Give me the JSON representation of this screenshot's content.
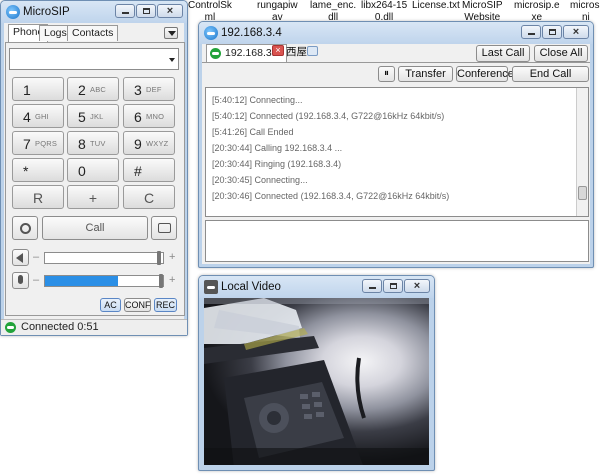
{
  "desktop_icons": [
    "ControlSk\nml",
    "rungapiw\nav",
    "lame_enc.\ndll",
    "libx264-15\n0.dll",
    "License.txt",
    "MicroSIP\nWebsite",
    "microsip.e\nxe",
    "microsi\nni"
  ],
  "microsip": {
    "title": "MicroSIP",
    "tabs": [
      "Phone",
      "Logs",
      "Contacts"
    ],
    "keys": [
      {
        "digit": "1",
        "letters": ""
      },
      {
        "digit": "2",
        "letters": "ABC"
      },
      {
        "digit": "3",
        "letters": "DEF"
      },
      {
        "digit": "4",
        "letters": "GHI"
      },
      {
        "digit": "5",
        "letters": "JKL"
      },
      {
        "digit": "6",
        "letters": "MNO"
      },
      {
        "digit": "7",
        "letters": "PQRS"
      },
      {
        "digit": "8",
        "letters": "TUV"
      },
      {
        "digit": "9",
        "letters": "WXYZ"
      },
      {
        "digit": "*",
        "letters": ""
      },
      {
        "digit": "0",
        "letters": ""
      },
      {
        "digit": "#",
        "letters": ""
      }
    ],
    "action_keys": [
      "R",
      "+",
      "C"
    ],
    "call_label": "Call",
    "speaker_level": 0.0,
    "mic_level": 0.62,
    "minus": "–",
    "plus": "+",
    "buttons": [
      "AC",
      "CONF",
      "REC"
    ],
    "status": "Connected 0:51",
    "accent": "#2b8fe6"
  },
  "call_window": {
    "title": "192.168.3.4",
    "tab_label": "192.168.3.4",
    "tab_extra": "西屋",
    "buttons": {
      "last_call": "Last Call",
      "close_all": "Close All",
      "pause": "⏸",
      "transfer": "Transfer",
      "conference": "Conference",
      "end_call": "End Call"
    },
    "log": [
      "[5:40:12]  Connecting...",
      "[5:40:12]  Connected (192.168.3.4, G722@16kHz 64kbit/s)",
      "[5:41:26]  Call Ended",
      "[20:30:44]  Calling 192.168.3.4 ...",
      "[20:30:44]  Ringing (192.168.3.4)",
      "[20:30:45]  Connecting...",
      "[20:30:46]  Connected (192.168.3.4, G722@16kHz 64kbit/s)"
    ]
  },
  "video_window": {
    "title": "Local Video"
  }
}
